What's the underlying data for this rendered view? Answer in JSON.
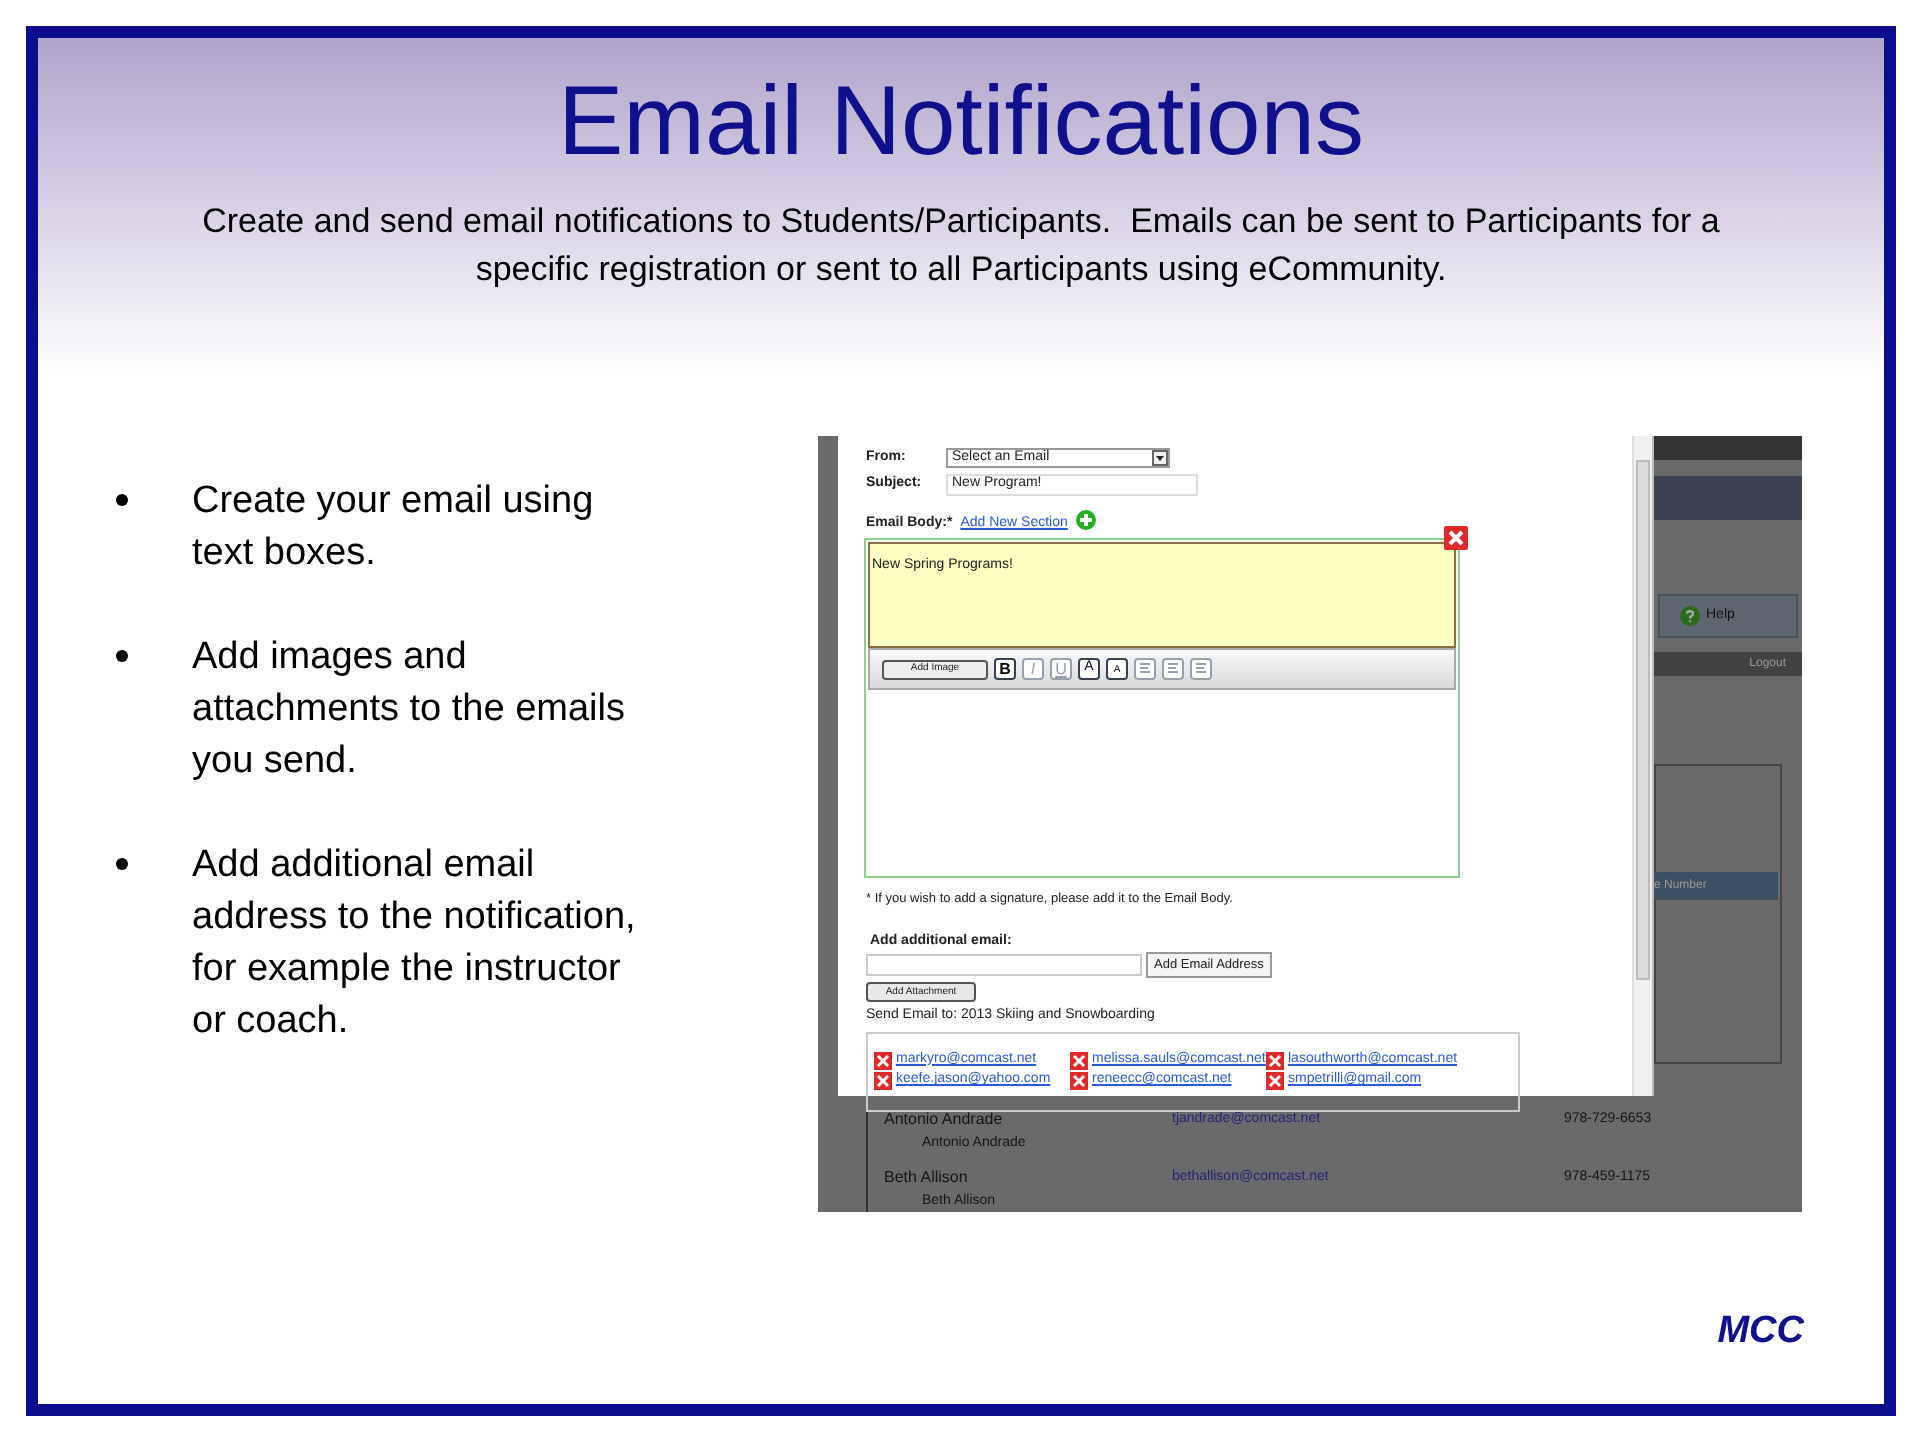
{
  "slide": {
    "title": "Email Notifications",
    "subtitle": "Create and send email notifications to Students/Participants.  Emails can be sent to Participants for a specific registration or sent to all Participants using eCommunity.",
    "bullets": [
      "Create your email using text boxes.",
      "Add images and attachments to the emails you send.",
      "Add additional email address to the notification, for example the instructor or coach."
    ],
    "footer": "MCC"
  },
  "screenshot": {
    "background": {
      "help_button": "Help",
      "logout": "Logout",
      "column_header": "e Number",
      "rows": [
        {
          "name": "Antonio Andrade",
          "subname": "Antonio Andrade",
          "email": "tjandrade@comcast.net",
          "phone": "978-729-6653"
        },
        {
          "name": "Beth Allison",
          "subname": "Beth Allison",
          "email": "bethallison@comcast.net",
          "phone": "978-459-1175"
        }
      ]
    },
    "form": {
      "from_label": "From:",
      "from_value": "Select an Email",
      "subject_label": "Subject:",
      "subject_value": "New Program!",
      "body_label": "Email Body:*",
      "add_section_link": "Add New Section",
      "section_text": "New Spring Programs!",
      "add_image_button": "Add Image",
      "toolbar": [
        {
          "kind": "bold",
          "label": "B",
          "disabled": false
        },
        {
          "kind": "italic",
          "label": "I",
          "disabled": true
        },
        {
          "kind": "underline",
          "label": "U",
          "disabled": true
        },
        {
          "kind": "sup",
          "label": "A",
          "disabled": false
        },
        {
          "kind": "sub",
          "label": "A",
          "disabled": false
        },
        {
          "kind": "align",
          "disabled": true
        },
        {
          "kind": "align",
          "disabled": true
        },
        {
          "kind": "align",
          "disabled": true
        }
      ],
      "signature_note": "* If you wish to add a signature, please add it to the Email Body.",
      "additional_label": "Add additional email:",
      "add_email_button": "Add Email Address",
      "add_attachment_button": "Add Attachment",
      "send_to": "Send Email to: 2013 Skiing and Snowboarding",
      "recipients": [
        "markyro@comcast.net",
        "melissa.sauls@comcast.net",
        "lasouthworth@comcast.net",
        "keefe.jason@yahoo.com",
        "reneecc@comcast.net",
        "smpetrilli@gmail.com"
      ]
    }
  }
}
